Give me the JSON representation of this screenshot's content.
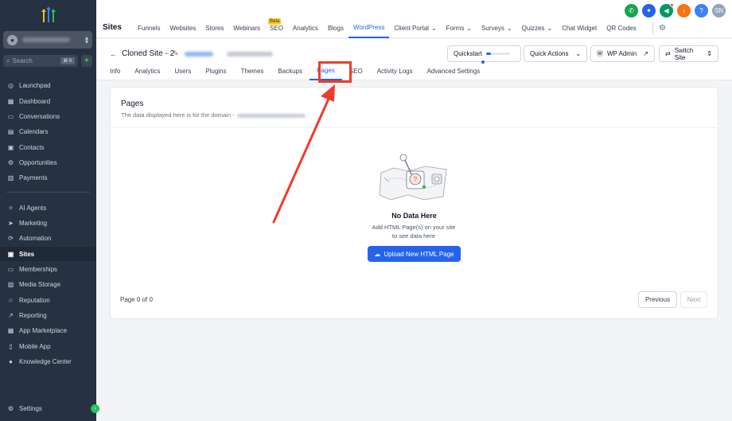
{
  "sidebar": {
    "search": {
      "placeholder": "Search",
      "shortcut": "⌘ K"
    },
    "items": [
      {
        "label": "Launchpad",
        "icon": "launchpad-icon"
      },
      {
        "label": "Dashboard",
        "icon": "dashboard-icon"
      },
      {
        "label": "Conversations",
        "icon": "chat-icon"
      },
      {
        "label": "Calendars",
        "icon": "calendar-icon"
      },
      {
        "label": "Contacts",
        "icon": "contacts-icon"
      },
      {
        "label": "Opportunities",
        "icon": "funnel-icon"
      },
      {
        "label": "Payments",
        "icon": "payments-icon"
      },
      {
        "label": "AI Agents",
        "icon": "sparkle-icon"
      },
      {
        "label": "Marketing",
        "icon": "send-icon"
      },
      {
        "label": "Automation",
        "icon": "automation-icon"
      },
      {
        "label": "Sites",
        "icon": "sites-icon",
        "active": true
      },
      {
        "label": "Memberships",
        "icon": "memberships-icon"
      },
      {
        "label": "Media Storage",
        "icon": "media-icon"
      },
      {
        "label": "Reputation",
        "icon": "star-icon"
      },
      {
        "label": "Reporting",
        "icon": "reporting-icon"
      },
      {
        "label": "App Marketplace",
        "icon": "grid-icon"
      },
      {
        "label": "Mobile App",
        "icon": "mobile-icon"
      },
      {
        "label": "Knowledge Center",
        "icon": "info-icon"
      }
    ],
    "settings_label": "Settings"
  },
  "topbar": {
    "title": "Sites",
    "nav": [
      {
        "label": "Funnels"
      },
      {
        "label": "Websites"
      },
      {
        "label": "Stores"
      },
      {
        "label": "Webinars"
      },
      {
        "label": "SEO",
        "badge": "Beta"
      },
      {
        "label": "Analytics"
      },
      {
        "label": "Blogs"
      },
      {
        "label": "WordPress",
        "active": true
      },
      {
        "label": "Client Portal",
        "dropdown": true
      },
      {
        "label": "Forms",
        "dropdown": true
      },
      {
        "label": "Surveys",
        "dropdown": true
      },
      {
        "label": "Quizzes",
        "dropdown": true
      },
      {
        "label": "Chat Widget"
      },
      {
        "label": "QR Codes"
      }
    ],
    "avatar_initials": "SN",
    "icon_colors": {
      "phone": "#16a34a",
      "magic": "#2563eb",
      "megaphone": "#059669",
      "bell": "#f97316",
      "help": "#3b82f6",
      "avatar": "#94a3b8"
    }
  },
  "site": {
    "name": "Cloned Site - 2",
    "buttons": {
      "quickstart": "Quickstart",
      "quick_actions": "Quick Actions",
      "wp_admin": "WP Admin",
      "switch_site": "Switch Site"
    },
    "tabs": [
      {
        "label": "Info"
      },
      {
        "label": "Analytics"
      },
      {
        "label": "Users"
      },
      {
        "label": "Plugins"
      },
      {
        "label": "Themes"
      },
      {
        "label": "Backups"
      },
      {
        "label": "Pages",
        "active": true
      },
      {
        "label": "SEO"
      },
      {
        "label": "Activity Logs"
      },
      {
        "label": "Advanced Settings"
      }
    ]
  },
  "pages": {
    "title": "Pages",
    "subtitle": "The data displayed here is for the domain -",
    "empty_title": "No Data Here",
    "empty_desc": "Add HTML Page(s) on your site to see data here",
    "upload_label": "Upload New HTML Page",
    "page_count": "Page 0 of 0",
    "previous": "Previous",
    "next": "Next"
  },
  "annotation_color": "#ef3b2c"
}
